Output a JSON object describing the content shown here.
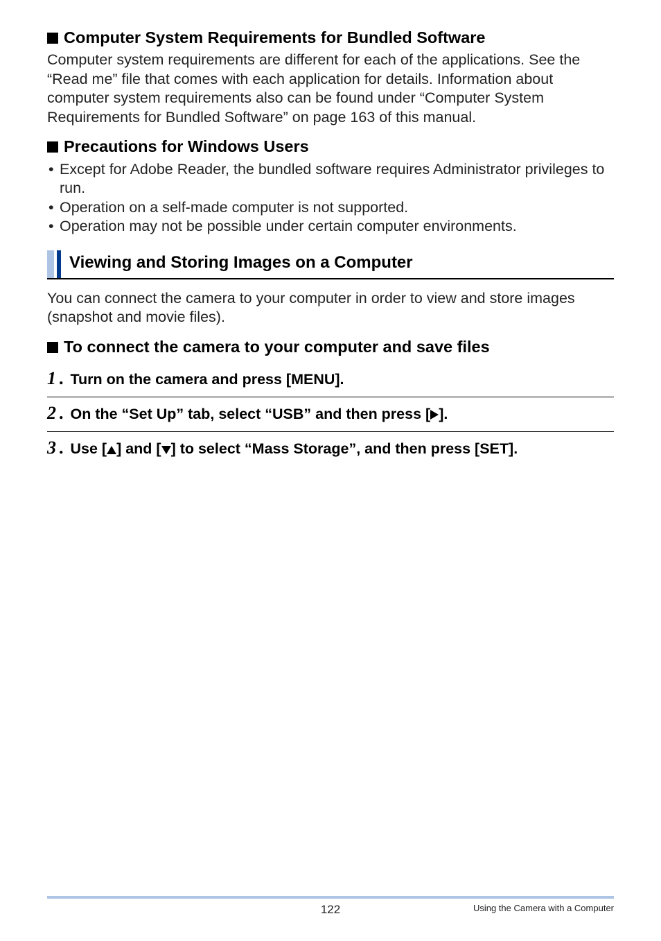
{
  "sections": {
    "s1": {
      "title": "Computer System Requirements for Bundled Software",
      "para": "Computer system requirements are different for each of the applications. See the “Read me” file that comes with each application for details. Information about computer system requirements also can be found under “Computer System Requirements for Bundled Software” on page 163 of this manual."
    },
    "s2": {
      "title": "Precautions for Windows Users",
      "bullets": [
        "Except for Adobe Reader, the bundled software requires Administrator privileges to run.",
        "Operation on a self-made computer is not supported.",
        "Operation may not be possible under certain computer environments."
      ]
    },
    "s3": {
      "title": "Viewing and Storing Images on a Computer",
      "para": "You can connect the camera to your computer in order to view and store images (snapshot and movie files)."
    },
    "s4": {
      "title": "To connect the camera to your computer and save files"
    }
  },
  "steps": {
    "n1": "1",
    "n2": "2",
    "n3": "3",
    "t1": "Turn on the camera and press [MENU].",
    "t2a": "On the “Set Up” tab, select “USB” and then press [",
    "t2b": "].",
    "t3a": "Use [",
    "t3b": "] and [",
    "t3c": "] to select “Mass Storage”, and then press [SET]."
  },
  "footer": {
    "page": "122",
    "right": "Using the Camera with a Computer"
  }
}
